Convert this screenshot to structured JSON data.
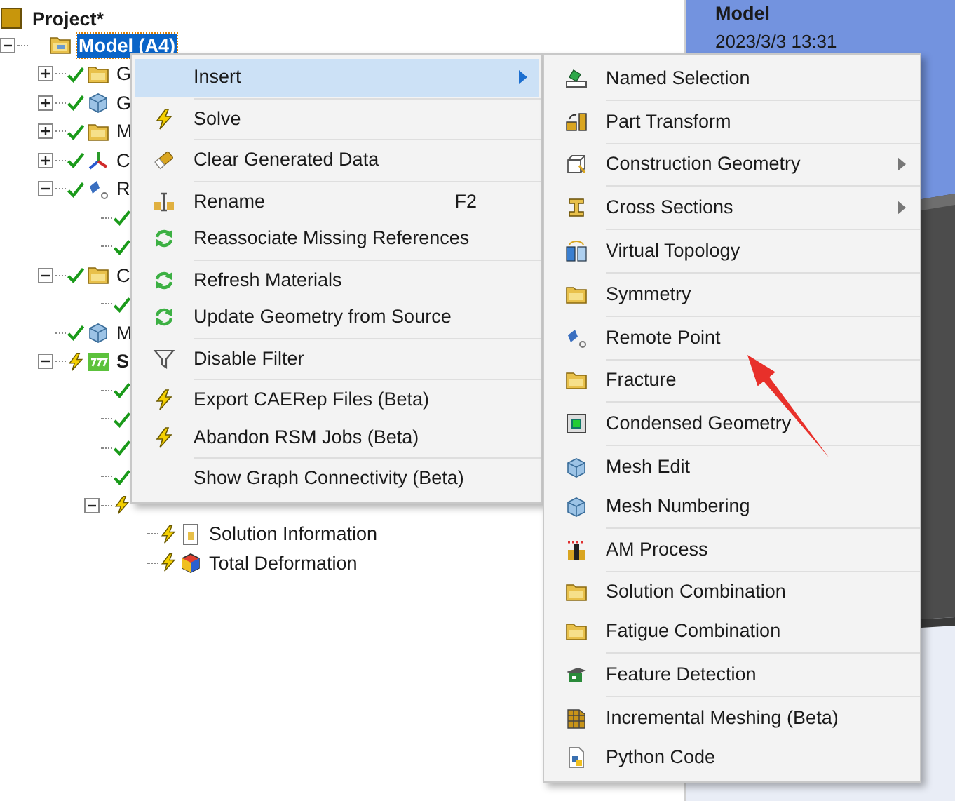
{
  "tree": {
    "project": {
      "label": "Project*",
      "kind": "project",
      "selected": false
    },
    "nodes": [
      {
        "label": "Model (A4)",
        "kind": "model",
        "selected": true,
        "expanded": true,
        "children": [
          {
            "label": "G",
            "kind": "folder",
            "done": true,
            "selected": false,
            "expanded": false
          },
          {
            "label": "G",
            "kind": "cube",
            "done": true,
            "selected": false,
            "expanded": false
          },
          {
            "label": "M",
            "kind": "folder",
            "done": true,
            "selected": false,
            "expanded": false
          },
          {
            "label": "C",
            "kind": "axes",
            "done": true,
            "selected": false,
            "expanded": false
          },
          {
            "label": "R",
            "kind": "remote",
            "done": true,
            "selected": false,
            "expanded": true,
            "children": [
              {
                "done": true,
                "selected": false
              },
              {
                "done": true,
                "selected": false
              }
            ]
          },
          {
            "label": "C",
            "kind": "folder",
            "done": true,
            "selected": false,
            "expanded": true,
            "children": [
              {
                "done": true,
                "selected": false
              }
            ]
          },
          {
            "label": "M",
            "kind": "cube",
            "done": true,
            "selected": false
          },
          {
            "label": "S",
            "kind": "solver",
            "done": false,
            "selected": false,
            "expanded": true,
            "children": [
              {
                "done": true,
                "selected": false
              },
              {
                "done": true,
                "selected": false
              },
              {
                "done": true,
                "selected": false
              },
              {
                "done": true,
                "selected": false
              },
              {
                "done": false,
                "selected": false,
                "expanded": true,
                "children": [
                  {
                    "label": "Solution Information",
                    "kind": "info",
                    "done": false,
                    "selected": false
                  },
                  {
                    "label": "Total Deformation",
                    "kind": "result",
                    "done": false,
                    "selected": false
                  }
                ]
              }
            ]
          }
        ]
      }
    ]
  },
  "viewport": {
    "title": "Model",
    "timestamp": "2023/3/3 13:31"
  },
  "context_menu": {
    "groups": [
      [
        {
          "label": "Insert",
          "selected": true,
          "submenu": true
        }
      ],
      [
        {
          "label": "Solve",
          "kind": "lightning",
          "selected": false
        }
      ],
      [
        {
          "label": "Clear Generated Data",
          "kind": "eraser",
          "selected": false
        }
      ],
      [
        {
          "label": "Rename",
          "kind": "rename",
          "selected": false,
          "shortcut": "F2"
        },
        {
          "label": "Reassociate Missing References",
          "kind": "refresh",
          "selected": false
        }
      ],
      [
        {
          "label": "Refresh Materials",
          "kind": "refresh",
          "selected": false
        },
        {
          "label": "Update Geometry from Source",
          "kind": "refresh",
          "selected": false
        }
      ],
      [
        {
          "label": "Disable Filter",
          "kind": "filter",
          "selected": false
        }
      ],
      [
        {
          "label": "Export CAERep Files (Beta)",
          "kind": "lightning",
          "selected": false
        },
        {
          "label": "Abandon RSM Jobs (Beta)",
          "kind": "lightning",
          "selected": false
        }
      ],
      [
        {
          "label": "Show Graph Connectivity (Beta)",
          "selected": false
        }
      ]
    ]
  },
  "submenu": {
    "groups": [
      [
        {
          "label": "Named Selection",
          "kind": "named-selection",
          "selected": false
        }
      ],
      [
        {
          "label": "Part Transform",
          "kind": "part-transform",
          "selected": false
        }
      ],
      [
        {
          "label": "Construction Geometry",
          "kind": "construction",
          "selected": false,
          "submenu": true
        }
      ],
      [
        {
          "label": "Cross Sections",
          "kind": "cross-section",
          "selected": false,
          "submenu": true
        }
      ],
      [
        {
          "label": "Virtual Topology",
          "kind": "virtual-topology",
          "selected": false
        }
      ],
      [
        {
          "label": "Symmetry",
          "kind": "folder",
          "selected": false
        }
      ],
      [
        {
          "label": "Remote Point",
          "kind": "remote",
          "selected": false
        }
      ],
      [
        {
          "label": "Fracture",
          "kind": "folder",
          "selected": false
        }
      ],
      [
        {
          "label": "Condensed Geometry",
          "kind": "condensed",
          "selected": false
        }
      ],
      [
        {
          "label": "Mesh Edit",
          "kind": "cube",
          "selected": false
        },
        {
          "label": "Mesh Numbering",
          "kind": "cube",
          "selected": false
        }
      ],
      [
        {
          "label": "AM Process",
          "kind": "am-process",
          "selected": false
        }
      ],
      [
        {
          "label": "Solution Combination",
          "kind": "folder",
          "selected": false
        },
        {
          "label": "Fatigue Combination",
          "kind": "folder",
          "selected": false
        }
      ],
      [
        {
          "label": "Feature Detection",
          "kind": "feature",
          "selected": false
        }
      ],
      [
        {
          "label": "Incremental Meshing (Beta)",
          "kind": "incremental",
          "selected": false
        },
        {
          "label": "Python Code",
          "kind": "python",
          "selected": false
        }
      ]
    ]
  }
}
